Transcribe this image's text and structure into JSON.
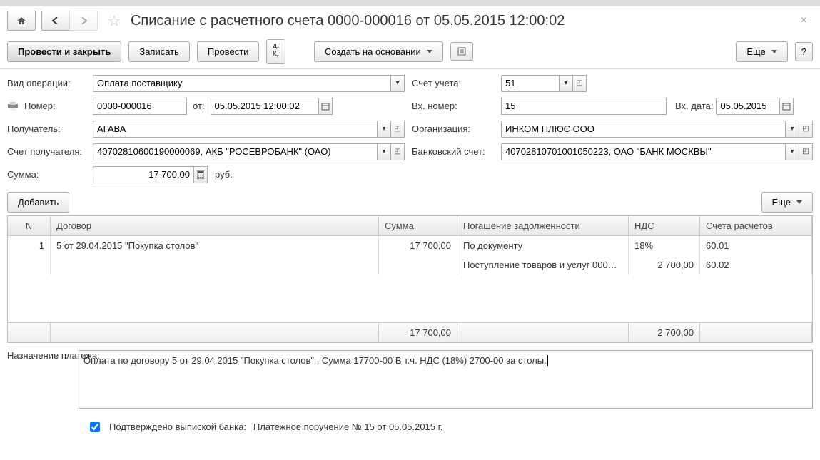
{
  "title": "Списание с расчетного счета 0000-000016 от 05.05.2015 12:00:02",
  "toolbar": {
    "post_close": "Провести и закрыть",
    "save": "Записать",
    "post": "Провести",
    "create_based": "Создать на основании",
    "more": "Еще",
    "help": "?"
  },
  "labels": {
    "op_type": "Вид операции:",
    "account": "Счет учета:",
    "number": "Номер:",
    "from": "от:",
    "in_number": "Вх. номер:",
    "in_date": "Вх. дата:",
    "recipient": "Получатель:",
    "org": "Организация:",
    "recip_acct": "Счет получателя:",
    "bank_acct": "Банковский счет:",
    "sum": "Сумма:",
    "rub": "руб.",
    "add": "Добавить",
    "purpose": "Назначение платежа:",
    "confirmed": "Подтверждено выпиской банка:"
  },
  "values": {
    "op_type": "Оплата поставщику",
    "account": "51",
    "number": "0000-000016",
    "date": "05.05.2015 12:00:02",
    "in_number": "15",
    "in_date": "05.05.2015",
    "recipient": "АГАВА",
    "org": "ИНКОМ ПЛЮС ООО",
    "recip_acct": "40702810600190000069, АКБ \"РОСЕВРОБАНК\" (ОАО)",
    "bank_acct": "40702810701001050223, ОАО \"БАНК МОСКВЫ\"",
    "sum": "17 700,00",
    "purpose": "Оплата по договору 5 от 29.04.2015 \"Покупка столов\" . Сумма 17700-00 В т.ч. НДС  (18%) 2700-00 за столы.",
    "payment_order": "Платежное поручение № 15 от 05.05.2015 г."
  },
  "table": {
    "headers": {
      "n": "N",
      "contract": "Договор",
      "sum": "Сумма",
      "debt": "Погашение задолженности",
      "vat": "НДС",
      "accounts": "Счета расчетов"
    },
    "rows": [
      {
        "n": "1",
        "contract": "5 от 29.04.2015 \"Покупка столов\"",
        "sum": "17 700,00",
        "debt": "По документу",
        "vat": "18%",
        "account": "60.01"
      },
      {
        "n": "",
        "contract": "",
        "sum": "",
        "debt": "Поступление товаров и услуг 000…",
        "vat": "2 700,00",
        "account": "60.02"
      }
    ],
    "footer": {
      "sum": "17 700,00",
      "vat": "2 700,00"
    }
  }
}
